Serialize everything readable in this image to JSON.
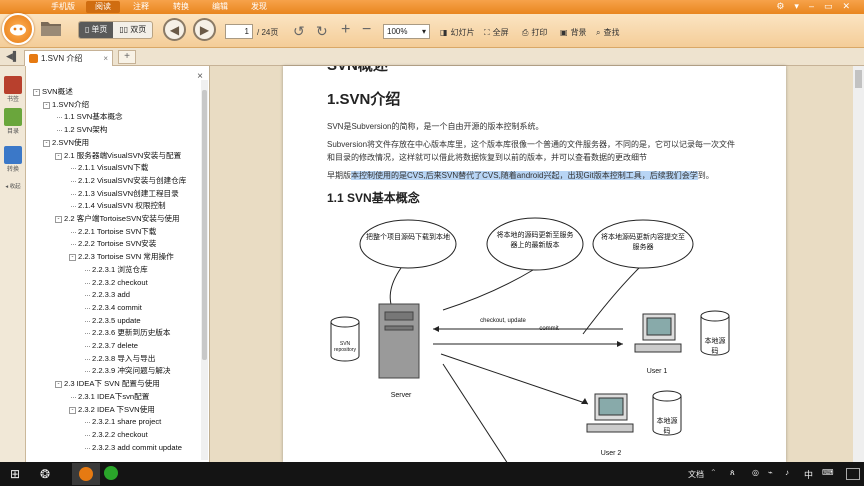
{
  "menu": {
    "items": [
      "手机版",
      "阅读",
      "注释",
      "转换",
      "编辑",
      "发现"
    ],
    "active_index": 1
  },
  "toolbar": {
    "view_single": "单页",
    "view_double": "双页",
    "page_current": "1",
    "page_total": "/ 24页",
    "zoom": "100%",
    "slideshow": "幻灯片",
    "fullscreen": "全屏",
    "print": "打印",
    "background": "背景",
    "find": "查找"
  },
  "tab": {
    "title": "1.SVN 介绍",
    "add": "+"
  },
  "rail": {
    "bookmarks": "书签",
    "toc": "目录",
    "convert": "转换",
    "collapse": "◂ 收起"
  },
  "outline": [
    {
      "text": "SVN概述",
      "level": 0,
      "exp": "-"
    },
    {
      "text": "1.SVN介绍",
      "level": 1,
      "exp": "-"
    },
    {
      "text": "1.1 SVN基本概念",
      "level": 2
    },
    {
      "text": "1.2 SVN架构",
      "level": 2
    },
    {
      "text": "2.SVN使用",
      "level": 1,
      "exp": "-"
    },
    {
      "text": "2.1 服务器端VisualSVN安装与配置",
      "level": 2,
      "exp": "-"
    },
    {
      "text": "2.1.1 VisualSVN下载",
      "level": 3
    },
    {
      "text": "2.1.2 VisualSVN安装与创建仓库",
      "level": 3
    },
    {
      "text": "2.1.3 VisualSVN创建工程目录",
      "level": 3
    },
    {
      "text": "2.1.4 VisualSVN 权限控制",
      "level": 3
    },
    {
      "text": "2.2 客户端TortoiseSVN安装与使用",
      "level": 2,
      "exp": "-"
    },
    {
      "text": "2.2.1 Tortoise SVN下载",
      "level": 3
    },
    {
      "text": "2.2.2 Tortoise SVN安装",
      "level": 3
    },
    {
      "text": "2.2.3 Tortoise SVN 常用操作",
      "level": 3,
      "exp": "-"
    },
    {
      "text": "2.2.3.1 浏览仓库",
      "level": 4
    },
    {
      "text": "2.2.3.2 checkout",
      "level": 4
    },
    {
      "text": "2.2.3.3 add",
      "level": 4
    },
    {
      "text": "2.2.3.4 commit",
      "level": 4
    },
    {
      "text": "2.2.3.5 update",
      "level": 4
    },
    {
      "text": "2.2.3.6 更新到历史版本",
      "level": 4
    },
    {
      "text": "2.2.3.7 delete",
      "level": 4
    },
    {
      "text": "2.2.3.8 导入与导出",
      "level": 4
    },
    {
      "text": "2.2.3.9 冲突问题与解决",
      "level": 4
    },
    {
      "text": "2.3 IDEA下 SVN 配置与使用",
      "level": 2,
      "exp": "-"
    },
    {
      "text": "2.3.1 IDEA下svn配置",
      "level": 3
    },
    {
      "text": "2.3.2 IDEA 下SVN使用",
      "level": 3,
      "exp": "-"
    },
    {
      "text": "2.3.2.1 share project",
      "level": 4
    },
    {
      "text": "2.3.2.2 checkout",
      "level": 4
    },
    {
      "text": "2.3.2.3 add commit update",
      "level": 4
    }
  ],
  "doc": {
    "top_heading": "SVN概述",
    "h_intro": "1.SVN介绍",
    "p1": "SVN是Subversion的简称，是一个自由开源的版本控制系统。",
    "p2a": "Subversion将文件存放在中心版本库里，这个版本库很像一个普通的文件服务器，不同的是，它可以记录每一次文件",
    "p2b": "和目录的修改情况，这样就可以借此将数据恢复到以前的版本，并可以查看数据的更改细节",
    "p3_pre": "早期版",
    "p3_hl": "本控制使用的是CVS,后来SVN替代了CVS,随着android兴起，出现Git版本控制工具，后续我们会学",
    "p3_post": "到。",
    "h_concept": "1.1 SVN基本概念"
  },
  "diagram": {
    "cloud1": "把整个项目源码下载到本地",
    "cloud2": "将本地的源码更新至服务器上的最新版本",
    "cloud3": "将本地源码更新内容提交至服务器",
    "repo": "SVN repository",
    "server": "Server",
    "arrow_checkout": "checkout, update",
    "arrow_commit": "commit",
    "user1": "User 1",
    "user2": "User 2",
    "local1": "本地源码",
    "local2": "本地源码"
  },
  "taskbar": {
    "ime_mode": "文档",
    "lang": "中",
    "time": "13:54"
  }
}
